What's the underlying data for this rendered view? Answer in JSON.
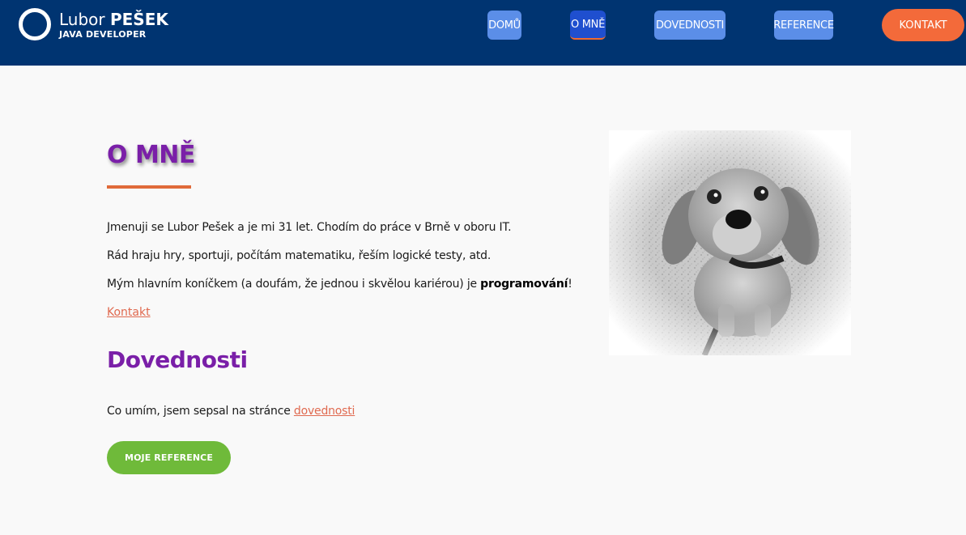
{
  "header": {
    "logo": {
      "first_name": "Lubor",
      "surname": "PEŠEK",
      "subtitle": "JAVA DEVELOPER"
    },
    "nav": {
      "home": "DOMŮ",
      "about": "O MNĚ",
      "skills": "DOVEDNOSTI",
      "references": "REFERENCE",
      "contact": "KONTAKT"
    }
  },
  "main": {
    "about_heading": "O MNĚ",
    "paragraphs": {
      "p1": "Jmenuji se Lubor Pešek a je mi 31 let. Chodím do práce v Brně v oboru IT.",
      "p2": "Rád hraju hry, sportuji, počítám matematiku, řeším logické testy, atd.",
      "p3_before": "Mým hlavním koníčkem (a doufám, že jednou i skvělou kariérou) je ",
      "p3_bold": "programování",
      "p3_after": "!"
    },
    "contact_link": "Kontakt",
    "skills_heading": "Dovednosti",
    "skills_text_before": "Co umím, jsem sepsal na stránce ",
    "skills_link": "dovednosti",
    "references_button": "MOJE REFERENCE"
  },
  "colors": {
    "header_bg": "#003471",
    "heading_purple": "#7a1fa8",
    "accent_orange": "#f36a3a",
    "button_green": "#6fba3a"
  }
}
